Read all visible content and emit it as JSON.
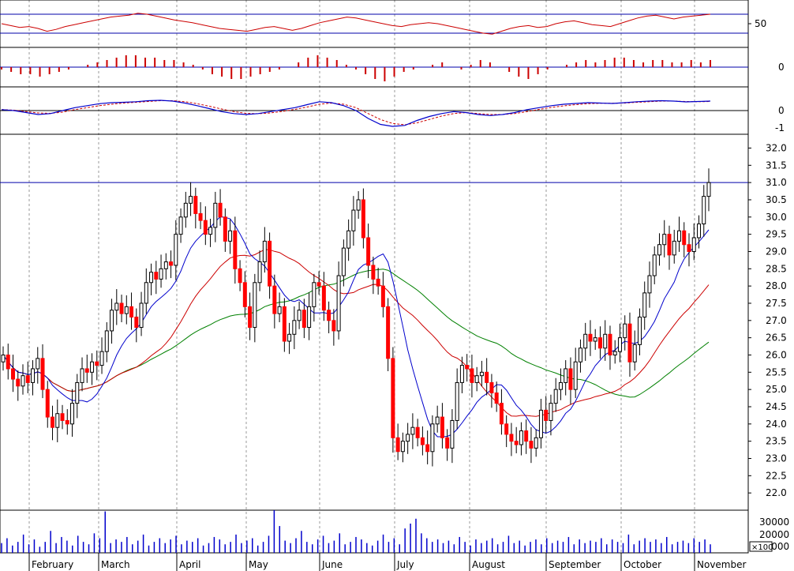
{
  "chart_data": {
    "type": "line",
    "price_panel": {
      "ylim": [
        21.5,
        32.4
      ],
      "y_ticks": [
        22.0,
        22.5,
        23.0,
        23.5,
        24.0,
        24.5,
        25.0,
        25.5,
        26.0,
        26.5,
        27.0,
        27.5,
        28.0,
        28.5,
        29.0,
        29.5,
        30.0,
        30.5,
        31.0,
        31.5,
        32.0
      ],
      "y_tick_labels": [
        "22.0",
        "22.5",
        "23.0",
        "23.5",
        "24.0",
        "24.5",
        "25.0",
        "25.5",
        "26.0",
        "26.5",
        "27.0",
        "27.5",
        "28.0",
        "28.5",
        "29.0",
        "29.5",
        "30.0",
        "30.5",
        "31.0",
        "31.5",
        "32.0"
      ],
      "reference_line": 31.0,
      "closes": [
        26.0,
        25.6,
        25.3,
        25.1,
        25.4,
        25.2,
        25.6,
        25.9,
        25.0,
        24.2,
        23.9,
        24.3,
        24.1,
        24.0,
        24.6,
        25.2,
        25.6,
        25.5,
        25.8,
        25.7,
        26.1,
        26.7,
        27.3,
        27.5,
        27.2,
        27.4,
        27.1,
        26.8,
        27.5,
        28.1,
        28.4,
        28.2,
        28.5,
        28.7,
        28.6,
        29.5,
        30.0,
        30.4,
        30.6,
        30.1,
        29.9,
        29.5,
        29.7,
        30.4,
        30.0,
        29.3,
        29.6,
        28.5,
        28.1,
        27.4,
        26.8,
        28.1,
        28.7,
        29.3,
        28.0,
        27.2,
        27.4,
        26.4,
        26.6,
        27.0,
        27.3,
        26.8,
        27.4,
        28.1,
        28.0,
        27.3,
        27.0,
        26.7,
        28.3,
        29.1,
        29.6,
        30.2,
        30.5,
        29.4,
        28.6,
        28.2,
        28.0,
        27.4,
        25.9,
        23.6,
        23.2,
        23.5,
        23.7,
        23.9,
        23.6,
        23.4,
        23.2,
        24.0,
        24.2,
        23.6,
        23.3,
        24.1,
        25.2,
        25.7,
        25.6,
        25.2,
        25.4,
        25.5,
        25.2,
        24.9,
        24.6,
        24.0,
        23.7,
        23.5,
        23.4,
        23.8,
        23.5,
        23.3,
        23.6,
        24.4,
        24.1,
        24.6,
        25.0,
        25.2,
        25.6,
        25.0,
        25.8,
        26.2,
        26.6,
        26.4,
        26.5,
        26.2,
        26.6,
        26.0,
        26.1,
        26.5,
        26.9,
        25.8,
        26.3,
        27.1,
        27.8,
        28.3,
        28.9,
        29.2,
        29.5,
        28.9,
        29.3,
        29.6,
        29.2,
        29.0,
        29.4,
        29.8,
        30.6,
        31.0
      ]
    },
    "rsi_panel": {
      "y_tick_labels": [
        "50"
      ],
      "upper_band": 70,
      "lower_band": 30,
      "series_values": [
        50,
        46,
        42,
        44,
        40,
        34,
        38,
        44,
        48,
        52,
        56,
        60,
        64,
        66,
        68,
        72,
        70,
        66,
        62,
        58,
        55,
        52,
        48,
        44,
        40,
        38,
        36,
        34,
        38,
        42,
        44,
        40,
        36,
        40,
        46,
        52,
        56,
        60,
        64,
        62,
        58,
        54,
        50,
        46,
        44,
        48,
        50,
        52,
        50,
        46,
        42,
        38,
        34,
        30,
        28,
        34,
        40,
        44,
        46,
        42,
        44,
        50,
        54,
        56,
        52,
        48,
        46,
        44,
        50,
        56,
        62,
        66,
        68,
        64,
        60,
        64,
        66,
        68,
        70
      ]
    },
    "histogram_panel": {
      "y_tick_labels": [
        "0"
      ],
      "bar_values": [
        -1,
        -2,
        -3,
        -3,
        -4,
        -3,
        -2,
        -1,
        0,
        1,
        2,
        3,
        4,
        5,
        5,
        4,
        4,
        3,
        3,
        2,
        1,
        -1,
        -3,
        -4,
        -5,
        -5,
        -4,
        -3,
        -2,
        -1,
        0,
        2,
        4,
        5,
        4,
        3,
        1,
        -1,
        -3,
        -5,
        -6,
        -4,
        -2,
        -1,
        0,
        1,
        2,
        0,
        -1,
        1,
        3,
        2,
        0,
        -2,
        -4,
        -5,
        -3,
        -1,
        0,
        1,
        2,
        3,
        2,
        3,
        4,
        4,
        3,
        2,
        3,
        3,
        2,
        2,
        3,
        2,
        3
      ]
    },
    "macd_panel": {
      "y_tick_labels": [
        "0",
        "-1"
      ],
      "macd_line": [
        0.05,
        0.0,
        -0.1,
        -0.2,
        -0.15,
        0.0,
        0.15,
        0.25,
        0.35,
        0.4,
        0.42,
        0.45,
        0.5,
        0.52,
        0.48,
        0.38,
        0.25,
        0.1,
        -0.05,
        -0.15,
        -0.2,
        -0.15,
        -0.05,
        0.05,
        0.15,
        0.3,
        0.45,
        0.4,
        0.25,
        0.0,
        -0.4,
        -0.7,
        -0.8,
        -0.75,
        -0.5,
        -0.3,
        -0.15,
        -0.05,
        -0.1,
        -0.2,
        -0.25,
        -0.2,
        -0.1,
        0.05,
        0.15,
        0.25,
        0.32,
        0.36,
        0.4,
        0.38,
        0.36,
        0.4,
        0.45,
        0.48,
        0.5,
        0.48,
        0.44,
        0.46,
        0.48
      ],
      "signal_line": [
        0.05,
        0.02,
        -0.05,
        -0.12,
        -0.14,
        -0.08,
        0.05,
        0.15,
        0.25,
        0.32,
        0.38,
        0.42,
        0.46,
        0.5,
        0.5,
        0.45,
        0.35,
        0.22,
        0.08,
        -0.05,
        -0.14,
        -0.16,
        -0.12,
        -0.04,
        0.06,
        0.18,
        0.32,
        0.38,
        0.32,
        0.15,
        -0.15,
        -0.45,
        -0.65,
        -0.72,
        -0.62,
        -0.45,
        -0.28,
        -0.15,
        -0.1,
        -0.15,
        -0.2,
        -0.2,
        -0.15,
        -0.05,
        0.06,
        0.16,
        0.24,
        0.3,
        0.35,
        0.37,
        0.37,
        0.38,
        0.42,
        0.45,
        0.48,
        0.48,
        0.46,
        0.45,
        0.46
      ]
    },
    "volume_panel": {
      "y_tick_labels": [
        "30000",
        "20000",
        "10000"
      ],
      "unit_label": "×100",
      "ylim": [
        0,
        35000
      ],
      "volumes": [
        8000,
        12000,
        6000,
        9000,
        15000,
        7000,
        11000,
        5000,
        9000,
        18000,
        8000,
        13000,
        10000,
        6000,
        14000,
        9000,
        7000,
        16000,
        12000,
        34000,
        8000,
        11000,
        9000,
        13000,
        7000,
        10000,
        15000,
        6000,
        9000,
        12000,
        8000,
        11000,
        14000,
        7000,
        10000,
        9000,
        12000,
        6000,
        8000,
        13000,
        11000,
        7000,
        9000,
        15000,
        8000,
        10000,
        12000,
        6000,
        9000,
        14000,
        35000,
        22000,
        10000,
        8000,
        12000,
        18000,
        9000,
        7000,
        11000,
        14000,
        8000,
        10000,
        16000,
        7000,
        9000,
        13000,
        11000,
        8000,
        6000,
        10000,
        15000,
        9000,
        12000,
        7000,
        20000,
        24000,
        28000,
        16000,
        12000,
        9000,
        11000,
        8000,
        10000,
        7000,
        13000,
        9000,
        6000,
        11000,
        8000,
        10000,
        12000,
        7000,
        9000,
        14000,
        8000,
        10000,
        6000,
        9000,
        11000,
        7000,
        12000,
        8000,
        10000,
        9000,
        13000,
        7000,
        11000,
        8000,
        10000,
        9000,
        12000,
        7000,
        11000,
        9000,
        8000,
        15000,
        7000,
        10000,
        12000,
        9000,
        11000,
        8000,
        13000,
        7000,
        9000,
        10000,
        8000,
        12000,
        9000,
        11000,
        7000
      ]
    },
    "x_tick_labels": [
      "February",
      "March",
      "April",
      "May",
      "June",
      "July",
      "August",
      "September",
      "October",
      "November"
    ],
    "grid": "vertical dotted at month boundaries",
    "colors": {
      "up_candle": "#ffffff",
      "down_candle": "#ff0000",
      "ma_short": "#0000cc",
      "ma_medium": "#cc0000",
      "ma_long": "#008000",
      "reference_line": "#0000aa",
      "rsi_line": "#cc0000",
      "histogram": "#cc0000",
      "macd_line": "#0000cc",
      "signal_line": "#cc0000",
      "volume": "#0000cc"
    }
  }
}
